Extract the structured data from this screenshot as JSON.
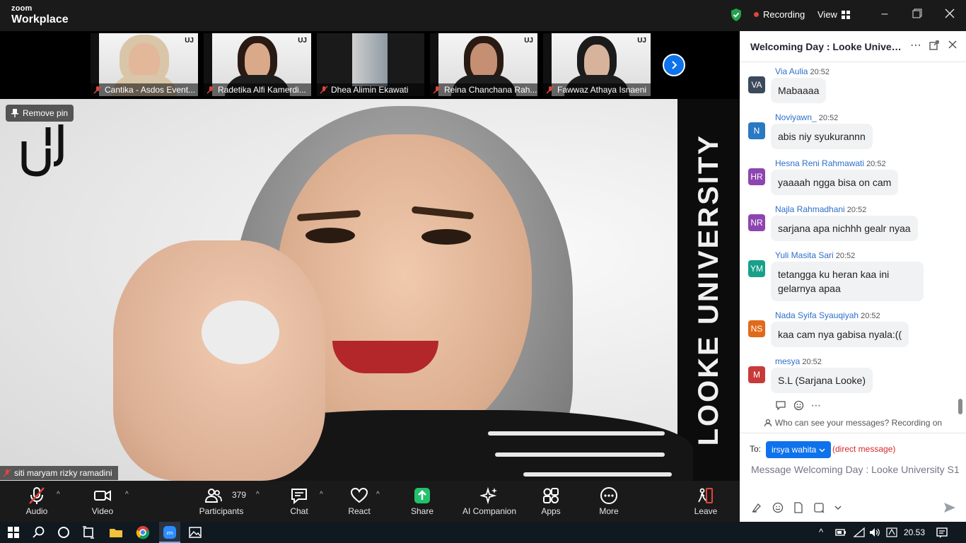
{
  "app": {
    "brand_top": "zoom",
    "brand_bottom": "Workplace",
    "recording_label": "Recording",
    "view_label": "View"
  },
  "thumbnails": [
    {
      "name": "Cantika - Asdos Event...",
      "skin": "#e2b79a",
      "hijab": "#d9c6a8"
    },
    {
      "name": "Radetika Alfi Kamerdi...",
      "skin": "#d9a98a",
      "hijab": "#2a1a14"
    },
    {
      "name": "Dhea Alimin Ekawati",
      "skin": "#c7c7c7",
      "hijab": "#9a9a9a"
    },
    {
      "name": "Reina Chanchana Rah...",
      "skin": "#c48f73",
      "hijab": "#2a1a14"
    },
    {
      "name": "Fawwaz Athaya Isnaeni",
      "skin": "#d8b39c",
      "hijab": "#1b1b1b"
    }
  ],
  "main_video": {
    "remove_pin_label": "Remove pin",
    "participant_name": "siti maryam rizky ramadini",
    "background_text": "LOOKE UNIVERSITY"
  },
  "toolbar": {
    "audio": "Audio",
    "video": "Video",
    "participants": "Participants",
    "participants_count": "379",
    "chat": "Chat",
    "react": "React",
    "share": "Share",
    "ai_companion": "AI Companion",
    "apps": "Apps",
    "more": "More",
    "leave": "Leave"
  },
  "chat": {
    "title": "Welcoming Day : Looke Universi...",
    "messages": [
      {
        "initials": "VA",
        "color": "#3b4a5a",
        "sender": "Via Aulia",
        "time": "20:52",
        "text": "Mabaaaa"
      },
      {
        "initials": "N",
        "color": "#2a79c2",
        "sender": "Noviyawn_",
        "time": "20:52",
        "text": "abis niy syukurannn"
      },
      {
        "initials": "HR",
        "color": "#8e45b0",
        "sender": "Hesna Reni Rahmawati",
        "time": "20:52",
        "text": "yaaaah ngga bisa on cam"
      },
      {
        "initials": "NR",
        "color": "#8e45b0",
        "sender": "Najla Rahmadhani",
        "time": "20:52",
        "text": "sarjana apa nichhh gealr nyaa"
      },
      {
        "initials": "YM",
        "color": "#17a08a",
        "sender": "Yuli Masita Sari",
        "time": "20:52",
        "text": "tetangga ku heran kaa ini gelarnya apaa"
      },
      {
        "initials": "NS",
        "color": "#e06a1b",
        "sender": "Nada Syifa Syauqiyah",
        "time": "20:52",
        "text": "kaa cam nya gabisa nyala:(("
      },
      {
        "initials": "M",
        "color": "#c83a3a",
        "sender": "mesya",
        "time": "20:52",
        "text": "S.L (Sarjana Looke)"
      }
    ],
    "who_can_see": "Who can see your messages? Recording on",
    "to_label": "To:",
    "recipient": "irsya wahita",
    "direct_label": "(direct message)",
    "input_placeholder": "Message Welcoming Day : Looke University S1"
  },
  "taskbar": {
    "time": "20.53"
  }
}
